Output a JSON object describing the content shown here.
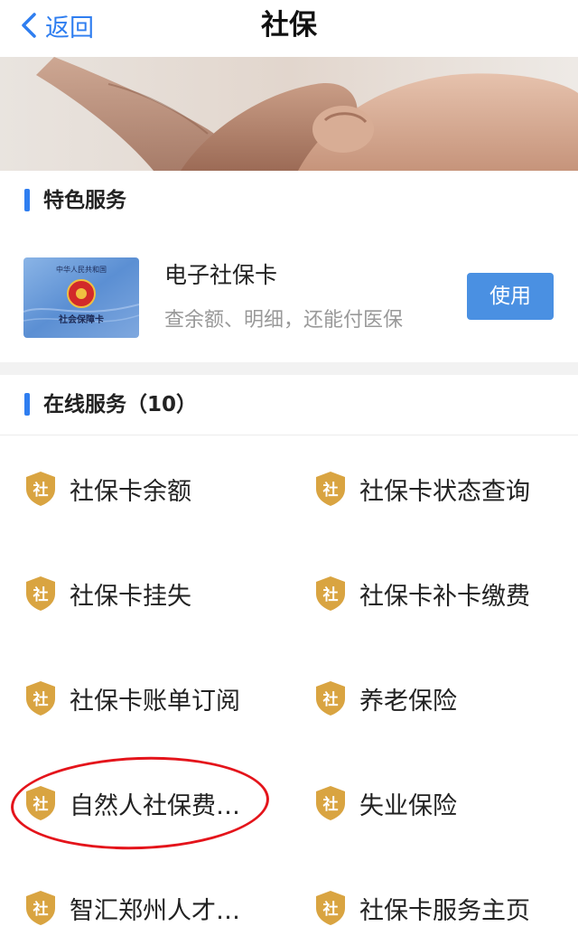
{
  "navbar": {
    "back_label": "返回",
    "title": "社保"
  },
  "featured": {
    "header": "特色服务",
    "card": {
      "title": "电子社保卡",
      "subtitle": "查余额、明细，还能付医保",
      "button_label": "使用",
      "image_text_top": "中华人民共和国",
      "image_text_bottom": "社会保障卡"
    }
  },
  "online": {
    "header": "在线服务（10）",
    "badge_char": "社",
    "items": [
      {
        "label": "社保卡余额"
      },
      {
        "label": "社保卡状态查询"
      },
      {
        "label": "社保卡挂失"
      },
      {
        "label": "社保卡补卡缴费"
      },
      {
        "label": "社保卡账单订阅"
      },
      {
        "label": "养老保险"
      },
      {
        "label": "自然人社保费…"
      },
      {
        "label": "失业保险"
      },
      {
        "label": "智汇郑州人才…"
      },
      {
        "label": "社保卡服务主页"
      }
    ]
  },
  "colors": {
    "accent": "#2f7ef0",
    "button": "#4a90e2",
    "badge": "#d9a441",
    "annotation": "#e4141b"
  }
}
